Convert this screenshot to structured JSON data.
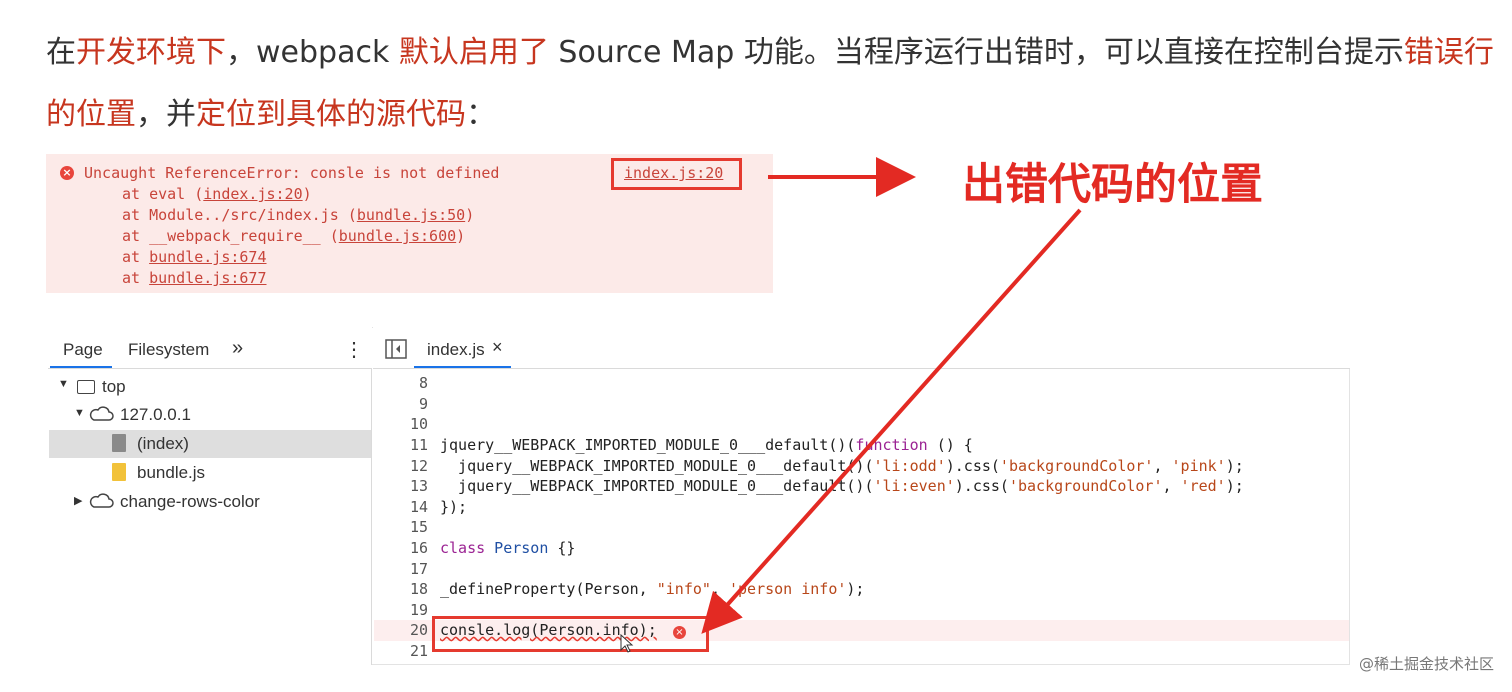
{
  "intro": {
    "line1_a": "在",
    "line1_b": "开发环境下",
    "line1_c": "，webpack ",
    "line1_d": "默认启用了",
    "line1_e": " Source Map 功能。当程序运行出错时，可以直接在控制台提示",
    "line1_f": "错误行",
    "line2_a": "的位置",
    "line2_b": "，并",
    "line2_c": "定位到具体的源代码",
    "line2_d": "："
  },
  "error": {
    "message": "Uncaught ReferenceError: consle is not defined",
    "location": "index.js:20",
    "stack": [
      {
        "prefix": "at eval (",
        "link": "index.js:20",
        "suffix": ")"
      },
      {
        "prefix": "at Module../src/index.js (",
        "link": "bundle.js:50",
        "suffix": ")"
      },
      {
        "prefix": "at __webpack_require__ (",
        "link": "bundle.js:600",
        "suffix": ")"
      },
      {
        "prefix": "at ",
        "link": "bundle.js:674",
        "suffix": ""
      },
      {
        "prefix": "at ",
        "link": "bundle.js:677",
        "suffix": ""
      }
    ]
  },
  "callout": "出错代码的位置",
  "devtools": {
    "left_tabs": {
      "page": "Page",
      "filesystem": "Filesystem",
      "more": "»",
      "menu": "⋮"
    },
    "tree": {
      "top": "top",
      "host": "127.0.0.1",
      "index": "(index)",
      "bundle": "bundle.js",
      "other": "change-rows-color"
    },
    "editor_tab": "index.js",
    "editor_close": "×",
    "line_numbers": [
      "8",
      "9",
      "10",
      "11",
      "12",
      "13",
      "14",
      "15",
      "16",
      "17",
      "18",
      "19",
      "20",
      "21"
    ],
    "code": {
      "l11a": "jquery__WEBPACK_IMPORTED_MODULE_0___default()(",
      "l11b": "function",
      "l11c": " () {",
      "l12a": "  jquery__WEBPACK_IMPORTED_MODULE_0___default()(",
      "l12b": "'li:odd'",
      "l12c": ").css(",
      "l12d": "'backgroundColor'",
      "l12e": ", ",
      "l12f": "'pink'",
      "l12g": ");",
      "l13a": "  jquery__WEBPACK_IMPORTED_MODULE_0___default()(",
      "l13b": "'li:even'",
      "l13c": ").css(",
      "l13d": "'backgroundColor'",
      "l13e": ", ",
      "l13f": "'red'",
      "l13g": ");",
      "l14": "});",
      "l16a": "class",
      "l16b": " Person",
      "l16c": " {}",
      "l18a": "_defineProperty(Person, ",
      "l18b": "\"info\"",
      "l18c": ", ",
      "l18d": "'person info'",
      "l18e": ");",
      "l20": "consle.log(Person.info);"
    }
  },
  "watermark": "@稀土掘金技术社区",
  "colors": {
    "accent_red": "#e32a23",
    "error_bg": "#fceae8",
    "active_tab": "#1a73e8"
  }
}
